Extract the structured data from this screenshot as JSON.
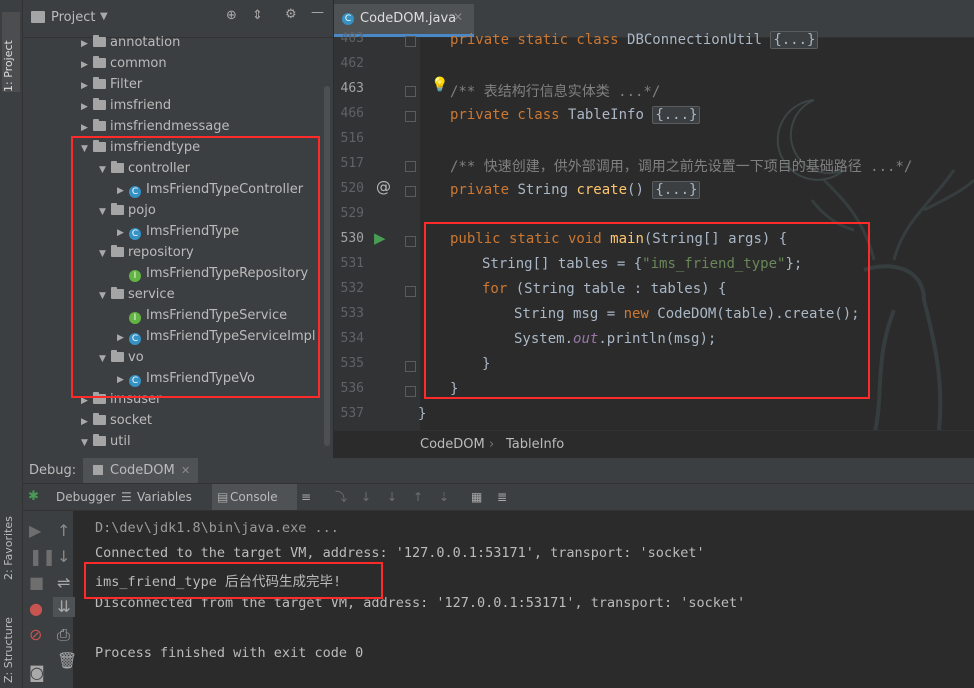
{
  "sidebar": {
    "project_tab": "1: Project",
    "favorites_tab": "2: Favorites",
    "structure_tab": "Z: Structure"
  },
  "project": {
    "title": "Project",
    "items": [
      {
        "label": "annotation",
        "kind": "package",
        "expanded": false
      },
      {
        "label": "common",
        "kind": "package",
        "expanded": false
      },
      {
        "label": "Filter",
        "kind": "package",
        "expanded": false
      },
      {
        "label": "imsfriend",
        "kind": "package",
        "expanded": false
      },
      {
        "label": "imsfriendmessage",
        "kind": "package",
        "expanded": false
      },
      {
        "label": "imsfriendtype",
        "kind": "package",
        "expanded": true
      },
      {
        "label": "controller",
        "kind": "package",
        "expanded": true
      },
      {
        "label": "ImsFriendTypeController",
        "kind": "class"
      },
      {
        "label": "pojo",
        "kind": "package",
        "expanded": true
      },
      {
        "label": "ImsFriendType",
        "kind": "class"
      },
      {
        "label": "repository",
        "kind": "package",
        "expanded": true
      },
      {
        "label": "ImsFriendTypeRepository",
        "kind": "interface"
      },
      {
        "label": "service",
        "kind": "package",
        "expanded": true
      },
      {
        "label": "ImsFriendTypeService",
        "kind": "interface"
      },
      {
        "label": "ImsFriendTypeServiceImpl",
        "kind": "class"
      },
      {
        "label": "vo",
        "kind": "package",
        "expanded": true
      },
      {
        "label": "ImsFriendTypeVo",
        "kind": "class"
      },
      {
        "label": "imsuser",
        "kind": "package",
        "expanded": false
      },
      {
        "label": "socket",
        "kind": "package",
        "expanded": false
      },
      {
        "label": "util",
        "kind": "package",
        "expanded": true
      }
    ]
  },
  "editor": {
    "tab_label": "CodeDOM.java",
    "line_numbers": [
      "403",
      "462",
      "463",
      "466",
      "516",
      "517",
      "520",
      "529",
      "530",
      "531",
      "532",
      "533",
      "534",
      "535",
      "536",
      "537"
    ],
    "lines": {
      "l403_kw": "private static class ",
      "l403_name": "DBConnectionUtil ",
      "l403_fold": "{...}",
      "l463": "/** 表结构行信息实体类 ...*/",
      "l466_kw": "private class ",
      "l466_name": "TableInfo ",
      "l466_fold": "{...}",
      "l517": "/** 快速创建，供外部调用，调用之前先设置一下项目的基础路径 ...*/",
      "l520_kw": "private ",
      "l520_type": "String ",
      "l520_fn": "create",
      "l520_rest": "() ",
      "l520_fold": "{...}",
      "l530_kw": "public static void ",
      "l530_fn": "main",
      "l530_rest": "(String[] args) {",
      "l531_a": "String[] tables = {",
      "l531_str": "\"ims_friend_type\"",
      "l531_b": "};",
      "l532_kw": "for ",
      "l532_rest": "(String table : tables) {",
      "l533_a": "String msg = ",
      "l533_kw": "new ",
      "l533_b": "CodeDOM(table).create();",
      "l534_a": "System.",
      "l534_st": "out",
      "l534_b": ".println(msg);",
      "l535": "}",
      "l536": "}",
      "l537": "}"
    },
    "breadcrumb": [
      "CodeDOM",
      "TableInfo"
    ]
  },
  "debug": {
    "title": "Debug:",
    "session_tab": "CodeDOM",
    "tabs": {
      "debugger": "Debugger",
      "variables": "Variables",
      "console": "Console"
    },
    "console_lines": [
      "D:\\dev\\jdk1.8\\bin\\java.exe ...",
      "Connected to the target VM, address: '127.0.0.1:53171', transport: 'socket'",
      "ims_friend_type 后台代码生成完毕!",
      "Disconnected from the target VM, address: '127.0.0.1:53171', transport: 'socket'",
      "",
      "Process finished with exit code 0"
    ]
  },
  "colors": {
    "highlight_box": "#ff2a2a",
    "keyword": "#cc7832",
    "string": "#6a8759",
    "function": "#ffc66d"
  }
}
